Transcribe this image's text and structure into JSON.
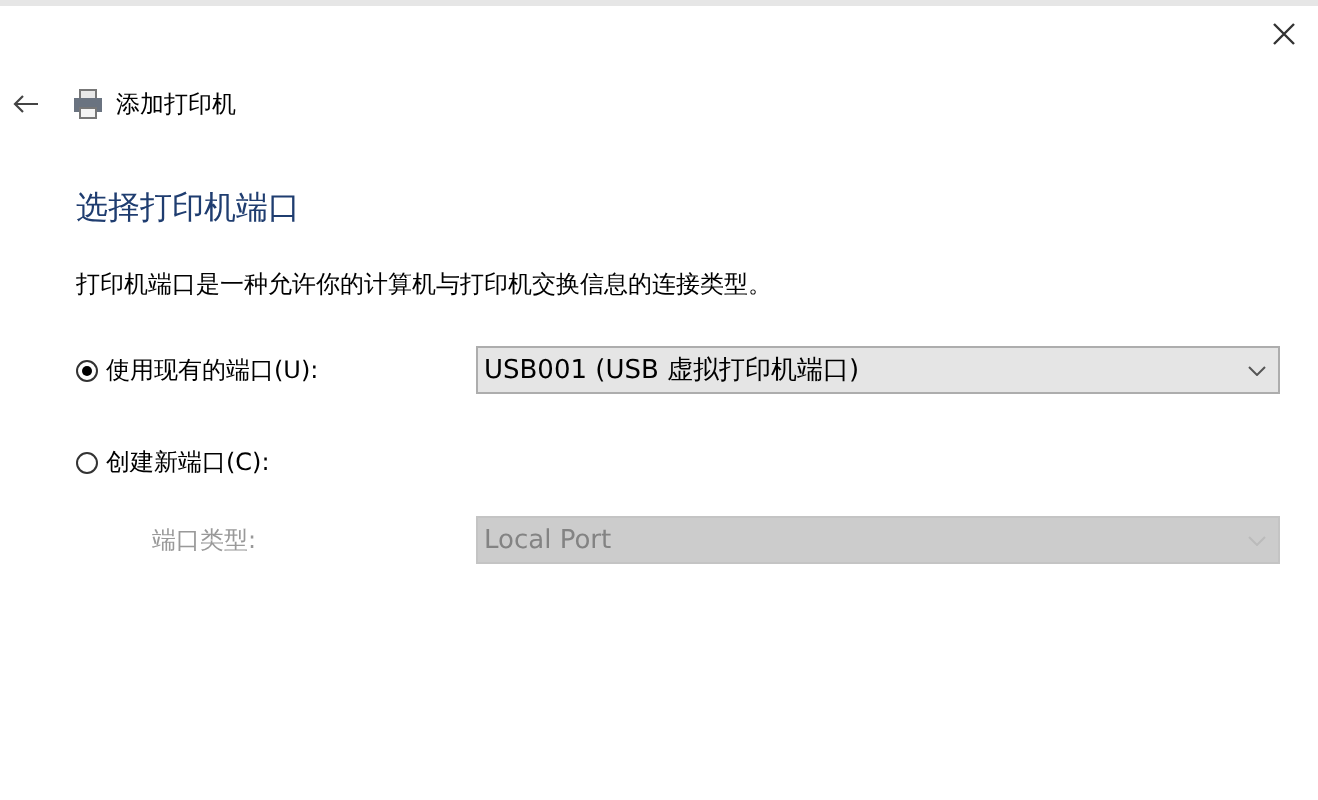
{
  "header": {
    "title": "添加打印机"
  },
  "heading": "选择打印机端口",
  "description": "打印机端口是一种允许你的计算机与打印机交换信息的连接类型。",
  "options": [
    {
      "label": "使用现有的端口(U):",
      "selected": true,
      "dropdown": {
        "value": "USB001 (USB 虚拟打印机端口)",
        "disabled": false
      }
    },
    {
      "label": "创建新端口(C):",
      "selected": false,
      "sub_label": "端口类型:",
      "dropdown": {
        "value": "Local Port",
        "disabled": true
      }
    }
  ]
}
